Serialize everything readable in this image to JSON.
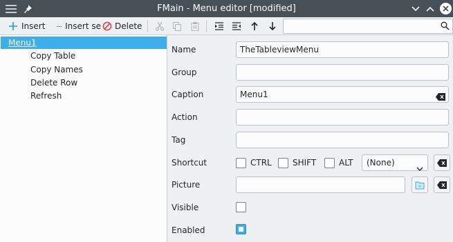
{
  "window": {
    "title": "FMain - Menu editor [modified]"
  },
  "toolbar": {
    "insert_label": "Insert",
    "insert_sep_label": "Insert se",
    "delete_label": "Delete",
    "search_placeholder": ""
  },
  "tree": {
    "root": "Menu1",
    "items": [
      {
        "label": "Copy Table"
      },
      {
        "label": "Copy Names"
      },
      {
        "label": "Delete Row"
      },
      {
        "label": "Refresh"
      }
    ]
  },
  "form": {
    "name_label": "Name",
    "name_value": "TheTableviewMenu",
    "group_label": "Group",
    "group_value": "",
    "caption_label": "Caption",
    "caption_value": "Menu1",
    "action_label": "Action",
    "action_value": "",
    "tag_label": "Tag",
    "tag_value": "",
    "shortcut_label": "Shortcut",
    "ctrl_label": "CTRL",
    "shift_label": "SHIFT",
    "alt_label": "ALT",
    "shortcut_key": "(None)",
    "picture_label": "Picture",
    "picture_value": "",
    "visible_label": "Visible",
    "visible_checked": false,
    "enabled_label": "Enabled",
    "enabled_checked": true
  },
  "colors": {
    "titlebar": "#475057",
    "accent": "#3daee9",
    "window_bg": "#eff0f1"
  },
  "icons": [
    "hamburger-menu-icon",
    "pin-icon",
    "minimize-icon",
    "maximize-icon",
    "close-icon",
    "plus-icon",
    "ellipsis-icon",
    "no-entry-icon",
    "cut-icon",
    "copy-icon",
    "paste-icon",
    "indent-icon",
    "unindent-icon",
    "arrow-up-icon",
    "arrow-down-icon",
    "search-icon",
    "clear-icon",
    "folder-icon",
    "chevron-down-icon"
  ]
}
